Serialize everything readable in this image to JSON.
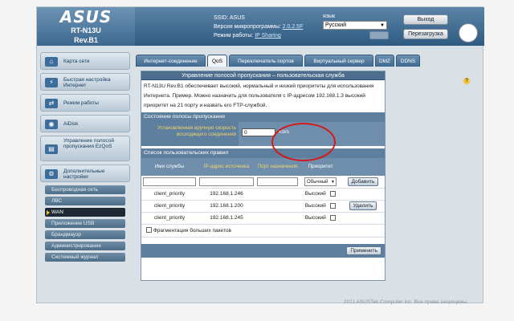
{
  "header": {
    "logo": "ASUS",
    "model": "RT-N13U",
    "rev": "Rev.B1",
    "ssid_label": "SSID:",
    "ssid_value": "ASUS",
    "firmware_label": "Версия микропрограммы:",
    "firmware_value": "2.0.2.5F",
    "mode_label": "Режим работы:",
    "mode_value": "IP Sharing",
    "lang_label": "язык",
    "lang_value": "Русский",
    "logout_label": "Выход",
    "reboot_label": "Перезагрузка"
  },
  "sidebar": {
    "items": [
      {
        "label": "Карта сети",
        "icon": "network-map-icon"
      },
      {
        "label": "Быстрая настройка Интернет",
        "icon": "quick-setup-icon"
      },
      {
        "label": "Режим работы",
        "icon": "operation-mode-icon"
      },
      {
        "label": "AiDisk",
        "icon": "disk-icon"
      },
      {
        "label": "Управление полосой пропускания EzQoS",
        "icon": "qos-icon"
      },
      {
        "label": "Дополнительные настройки",
        "icon": "advanced-settings-icon"
      }
    ],
    "sub_items": [
      {
        "label": "Беспроводная сеть"
      },
      {
        "label": "ЛВС"
      },
      {
        "label": "WAN"
      },
      {
        "label": "Приложение USB"
      },
      {
        "label": "Брандмауэр"
      },
      {
        "label": "Администрирование"
      },
      {
        "label": "Системный журнал"
      }
    ]
  },
  "tabs": [
    {
      "label": "Интернет-соединение"
    },
    {
      "label": "QoS"
    },
    {
      "label": "Переключатель портов"
    },
    {
      "label": "Виртуальный сервер"
    },
    {
      "label": "DMZ"
    },
    {
      "label": "DDNS"
    }
  ],
  "content": {
    "title": "Управление полосой пропускания – пользовательская служба",
    "description": "RT-N13U Rev.B1 обеспечивает высокий, нормальный и низкий приоритеты для использования Интернета. Пример. Можно назначить для пользователя с IP-адресом 192.168.1.3 высокий приоритет на 21 порту и назвать его FTP-службой.",
    "bandwidth_section": "Состояние полосы пропускания",
    "bandwidth_label": "Установленная вручную скорость восходящего соединения",
    "bandwidth_value": "0",
    "bandwidth_unit": "Kb/s",
    "rules_section": "Список пользовательских правил",
    "columns": {
      "service": "Имя службы",
      "source_ip": "IP-адрес источника",
      "port": "Порт назначения",
      "priority": "Приоритет"
    },
    "new_rule_priority": "Обычный",
    "add_label": "Добавить",
    "rules": [
      {
        "service": "client_priority",
        "ip": "192.168.1.246",
        "port": "",
        "priority": "Высокий"
      },
      {
        "service": "client_priority",
        "ip": "192.168.1.200",
        "port": "",
        "priority": "Высокий"
      },
      {
        "service": "client_priority",
        "ip": "192.168.1.245",
        "port": "",
        "priority": "Высокий"
      }
    ],
    "delete_label": "Удалить",
    "fragment_label": "Фрагментация больших пакетов",
    "apply_label": "Применить"
  },
  "footer": "2011 ASUSTek Computer Inc. Все права защищены."
}
